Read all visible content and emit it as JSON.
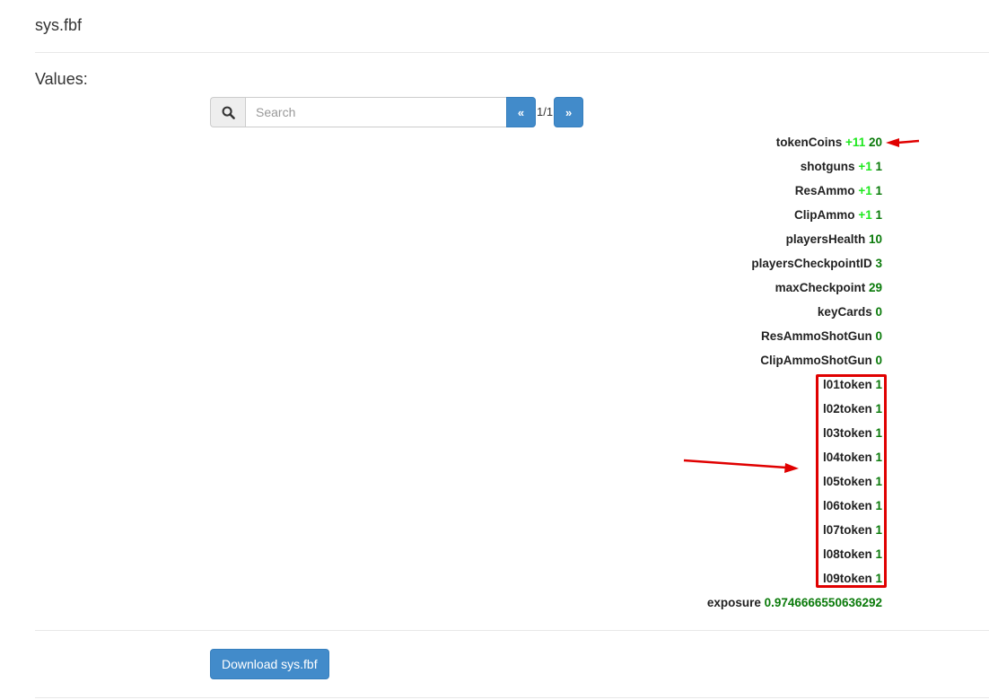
{
  "header": {
    "file_name": "sys.fbf"
  },
  "section": {
    "values_label": "Values:"
  },
  "search": {
    "placeholder": "Search",
    "prev_label": "«",
    "next_label": "»",
    "page_indicator": "1/1",
    "icon": "search-icon"
  },
  "values": [
    {
      "key": "tokenCoins",
      "delta": "+11",
      "value": "20"
    },
    {
      "key": "shotguns",
      "delta": "+1",
      "value": "1"
    },
    {
      "key": "ResAmmo",
      "delta": "+1",
      "value": "1"
    },
    {
      "key": "ClipAmmo",
      "delta": "+1",
      "value": "1"
    },
    {
      "key": "playersHealth",
      "delta": "",
      "value": "10"
    },
    {
      "key": "playersCheckpointID",
      "delta": "",
      "value": "3"
    },
    {
      "key": "maxCheckpoint",
      "delta": "",
      "value": "29"
    },
    {
      "key": "keyCards",
      "delta": "",
      "value": "0"
    },
    {
      "key": "ResAmmoShotGun",
      "delta": "",
      "value": "0"
    },
    {
      "key": "ClipAmmoShotGun",
      "delta": "",
      "value": "0"
    },
    {
      "key": "l01token",
      "delta": "",
      "value": "1"
    },
    {
      "key": "l02token",
      "delta": "",
      "value": "1"
    },
    {
      "key": "l03token",
      "delta": "",
      "value": "1"
    },
    {
      "key": "l04token",
      "delta": "",
      "value": "1"
    },
    {
      "key": "l05token",
      "delta": "",
      "value": "1"
    },
    {
      "key": "l06token",
      "delta": "",
      "value": "1"
    },
    {
      "key": "l07token",
      "delta": "",
      "value": "1"
    },
    {
      "key": "l08token",
      "delta": "",
      "value": "1"
    },
    {
      "key": "l09token",
      "delta": "",
      "value": "1"
    },
    {
      "key": "exposure",
      "delta": "",
      "value": "0.9746666550636292"
    }
  ],
  "actions": {
    "download_label": "Download sys.fbf"
  },
  "colors": {
    "primary": "#428bca",
    "delta_green": "#1ee81e",
    "value_green": "#0a7a0a",
    "annotation_red": "#e00000"
  }
}
